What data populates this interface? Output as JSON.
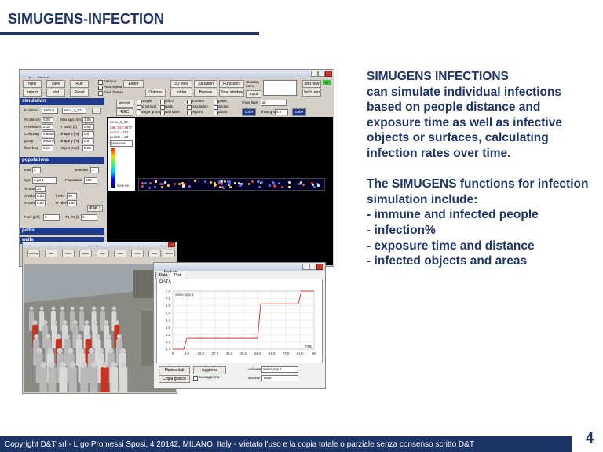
{
  "slide": {
    "title": "SIMUGENS-INFECTION",
    "heading": "SIMUGENS INFECTIONS",
    "paragraph1": "can simulate individual infections based on people distance and exposure time as well as infective objects or surfaces, calculating infection rates over time.",
    "paragraph2_intro": "The SIMUGENS functions for infection simulation include:",
    "bullets": [
      "- immune and infected people",
      "- infection%",
      "- exposure time and distance",
      "- infected objects and areas"
    ],
    "page_number": "4",
    "footer": "Copyright  D&T srl - L.go Promessi Sposi, 4 20142, MILANO, Italy -  Vietato l'uso e la copia totale o parziale senza consenso scritto D&T"
  },
  "colors": {
    "brand_navy": "#1d3466",
    "section_blue": "#1f3a8a",
    "chart_line": "#d23a3a",
    "sim_background": "#000000"
  },
  "main_window": {
    "title": "SimuGENS",
    "toolbar": {
      "new": "New",
      "save": "save",
      "run": "Run",
      "import": "import",
      "stat": "stat",
      "reset": "Reset",
      "fast_run": "Fast run",
      "auto_repeat": "Auto repeat",
      "save_frames": "Save frames",
      "editor": "Editor",
      "options": "Options",
      "view_3d": "3D view",
      "folder": "folder",
      "situation": "Situation",
      "browse": "Browse",
      "functions": "Functions",
      "time_window": "Time window",
      "situation_name": "situation name",
      "input": "input",
      "add_new": "add new",
      "fetch_run": "fetch run",
      "status": "ok"
    },
    "simulation_section": {
      "label": "simulation",
      "fields": [
        {
          "label": "End time",
          "value": "1000.0"
        },
        {
          "label": "R collision",
          "value": "0.38"
        },
        {
          "label": "R freedom",
          "value": "2.29"
        },
        {
          "label": "Coll Drag",
          "value": "0.9800"
        },
        {
          "label": "group",
          "value": "9000.0"
        },
        {
          "label": "filter freq",
          "value": "0.10"
        }
      ],
      "name_value": "Simu_a_02",
      "right_fields": [
        {
          "label": "Max spd [m/s]",
          "value": "1.00"
        },
        {
          "label": "T panic [s]",
          "value": "0.00"
        },
        {
          "label": "shape x [m]",
          "value": "0.0"
        },
        {
          "label": "shape y [m]",
          "value": "0.0"
        },
        {
          "label": "object [N:d]",
          "value": "0.00"
        }
      ]
    },
    "populations_section": {
      "label": "populations",
      "total_label": "total",
      "total_value": "2",
      "selected_label": "selected",
      "selected_value": "1",
      "type_label": "type",
      "type_value": "a-pe 1",
      "population_label": "Population",
      "population_value": "500",
      "rows": [
        {
          "label": "% slow",
          "value": "20"
        },
        {
          "label": "S velocity",
          "value": "0.50"
        },
        {
          "label": "S vdev",
          "value": "0.80"
        }
      ],
      "rows_right": [
        {
          "label": "f velo",
          "value": "80"
        },
        {
          "label": "R vdev",
          "value": "1.50"
        }
      ],
      "flow_label": "Flow [p/h]",
      "flow_value": "0",
      "time_label": "T1, T2 [t]",
      "time_value": "0",
      "draw_btn": "draw >"
    },
    "bottom_sections": [
      "paths",
      "walls"
    ],
    "view_panel": {
      "details": "details",
      "rec": "REC",
      "people": "people",
      "id_symbol": "id symbol",
      "target_group": "target group",
      "infect": "infect",
      "walls": "walls",
      "wall_label": "wall label",
      "immune": "immune",
      "population": "population",
      "regions": "regions",
      "poles": "poles",
      "arrows": "arrows",
      "doors": "doors",
      "show_layer_label": "show layer",
      "show_layer_value": "all",
      "show_grid_label": "show grid",
      "show_grid_value": "5.0",
      "color_btn": "color"
    },
    "legend": {
      "label": "Simu_a_02",
      "lines": [
        "Idle: 0s / 4877",
        "n-occ = 162",
        "perCR = 28"
      ],
      "dropdown": "pressure",
      "scale_top": "",
      "scale_bottom": "0.00E+00"
    }
  },
  "view3d_window": {
    "toolbar_items": [
      "start/stop",
      "clear",
      "frame",
      "pause",
      "light",
      "scale",
      "reset",
      "save",
      "objects"
    ]
  },
  "chart_window": {
    "title": "Analysis",
    "tabs": [
      "Data",
      "Plot"
    ],
    "active_tab": "Plot",
    "panel_title": "DATA",
    "buttons": {
      "save_data": "Mostra dati",
      "copy_chart": "Copia grafico",
      "update": "Aggiorna",
      "autoupdate": "autoaggiorna"
    },
    "selectors": [
      {
        "label": "ordinate",
        "value": "Selez.pop 1"
      },
      {
        "label": "ascisse",
        "value": "TIME"
      }
    ]
  },
  "chart_data": {
    "type": "line",
    "legend": "Selez.pop 1",
    "xlabel": "TIME",
    "ylabel": "",
    "x_ticks": [
      "0",
      "9.0",
      "18.0",
      "27.0",
      "36.0",
      "45.0",
      "54.0",
      "63.0",
      "72.0",
      "81.0",
      "90"
    ],
    "y_ticks": [
      "4.4",
      "4.8",
      "5.2",
      "5.6",
      "6.0",
      "6.4",
      "6.8",
      "7.2",
      "7.6"
    ],
    "xlim": [
      0,
      90
    ],
    "ylim": [
      4.4,
      7.6
    ],
    "series": [
      {
        "name": "Selez.pop 1",
        "x": [
          0,
          7,
          9,
          54,
          56,
          80,
          82,
          90
        ],
        "y": [
          4.4,
          4.4,
          5.0,
          5.0,
          6.9,
          6.9,
          7.6,
          7.6
        ]
      }
    ]
  }
}
